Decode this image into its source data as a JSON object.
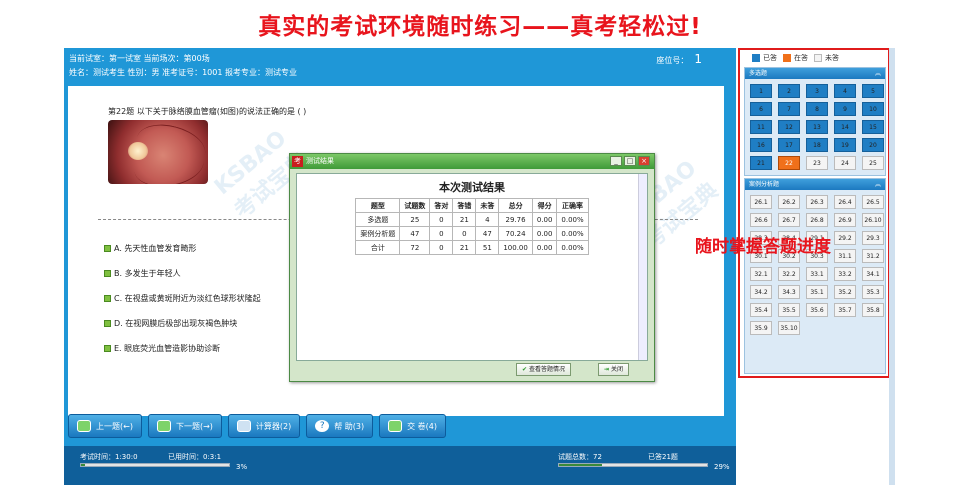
{
  "banner": {
    "text": "真实的考试环境随时练习——真考轻松过!"
  },
  "header": {
    "line1": "当前试室：第一试室      当前场次：第00场",
    "line2": "姓名：测试考生   性别：男   准考证号：1001   报考专业：测试专业",
    "seat_label": "座位号：",
    "seat_value": "1"
  },
  "question": {
    "title": "第22题   以下关于脉络膜血管瘤(如图)的说法正确的是   (      )",
    "options": [
      "A. 先天性血管发育畸形",
      "B. 多发生于年轻人",
      "C. 在视盘或黄斑附近为淡红色球形状隆起",
      "D. 在视网膜后极部出现灰褐色肿块",
      "E. 眼底荧光血管造影协助诊断"
    ]
  },
  "watermark": {
    "line1": "KSBAO",
    "line2": "考试宝典"
  },
  "buttons": {
    "prev": "上一题(←)",
    "next": "下一题(→)",
    "calc": "计算器(2)",
    "help": "帮 助(3)",
    "submit": "交 卷(4)"
  },
  "footer": {
    "exam_time": "考试时间：1:30:0",
    "used_time": "已用时间：0:3:1",
    "time_pct_label": "3%",
    "time_pct": 3,
    "total": "试题总数：72",
    "answered": "已答21题",
    "ans_pct_label": "29%",
    "ans_pct": 29
  },
  "legend": {
    "answered": "已答",
    "current": "在答",
    "unanswered": "未答"
  },
  "sections": {
    "mc": {
      "title": "多选题",
      "cells": [
        "1",
        "2",
        "3",
        "4",
        "5",
        "6",
        "7",
        "8",
        "9",
        "10",
        "11",
        "12",
        "13",
        "14",
        "15",
        "16",
        "17",
        "18",
        "19",
        "20",
        "21",
        "22",
        "23",
        "24",
        "25"
      ]
    },
    "case": {
      "title": "案例分析题",
      "cells": [
        "26.1",
        "26.2",
        "26.3",
        "26.4",
        "26.5",
        "26.6",
        "26.7",
        "26.8",
        "26.9",
        "26.10",
        "28.3",
        "28.4",
        "29.1",
        "29.2",
        "29.3",
        "30.1",
        "30.2",
        "30.3",
        "31.1",
        "31.2",
        "32.1",
        "32.2",
        "33.1",
        "33.2",
        "34.1",
        "34.2",
        "34.3",
        "35.1",
        "35.2",
        "35.3",
        "35.4",
        "35.5",
        "35.6",
        "35.7",
        "35.8",
        "35.9",
        "35.10"
      ]
    }
  },
  "annotation": "随时掌握答题进度",
  "dialog": {
    "title": "测试结果",
    "icon_char": "考",
    "heading": "本次测试结果",
    "columns": [
      "题型",
      "试题数",
      "答对",
      "答错",
      "未答",
      "总分",
      "得分",
      "正确率"
    ],
    "rows": [
      [
        "多选题",
        "25",
        "0",
        "21",
        "4",
        "29.76",
        "0.00",
        "0.00%"
      ],
      [
        "案例分析题",
        "47",
        "0",
        "0",
        "47",
        "70.24",
        "0.00",
        "0.00%"
      ],
      [
        "合计",
        "72",
        "0",
        "21",
        "51",
        "100.00",
        "0.00",
        "0.00%"
      ]
    ],
    "view_btn": "查看答题情况",
    "close_btn": "关闭"
  },
  "colors": {
    "accent": "#1f97d7",
    "answered": "#1f7ec4",
    "current": "#f0701a",
    "highlight": "#e01b1b"
  }
}
